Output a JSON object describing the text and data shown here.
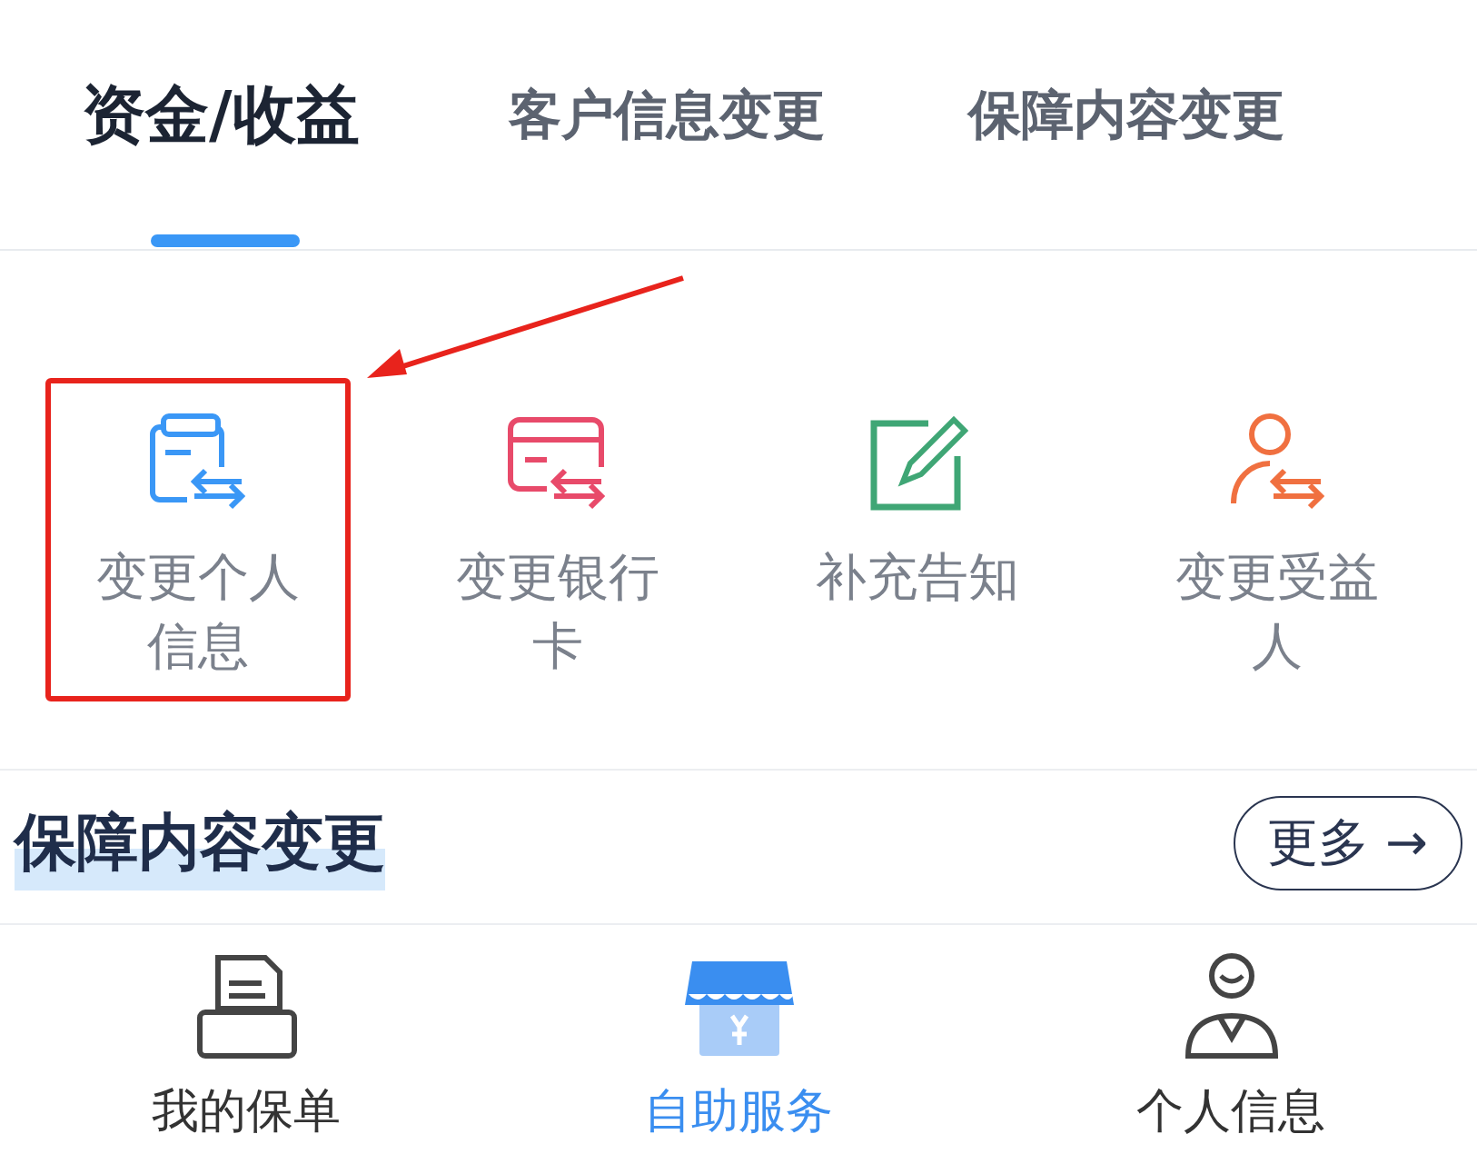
{
  "top_tabs": [
    {
      "label": "资金/收益",
      "selected": true
    },
    {
      "label": "客户信息变更",
      "selected": false
    },
    {
      "label": "保障内容变更",
      "selected": false
    }
  ],
  "sections": [
    {
      "items": [
        {
          "label": "变更个人信息",
          "kind": "doc-swap",
          "color": "#3a97f6",
          "highlighted": true
        },
        {
          "label": "变更银行卡",
          "kind": "card-swap",
          "color": "#e84a6a",
          "highlighted": false
        },
        {
          "label": "补充告知",
          "kind": "edit",
          "color": "#3fa675",
          "highlighted": false
        },
        {
          "label": "变更受益人",
          "kind": "person-swap",
          "color": "#f07040",
          "highlighted": false
        }
      ]
    },
    {
      "title": "保障内容变更",
      "more": "更多 →"
    }
  ],
  "bottom_nav": [
    {
      "label": "我的保单",
      "kind": "printer",
      "selected": false
    },
    {
      "label": "自助服务",
      "kind": "shop",
      "selected": true
    },
    {
      "label": "个人信息",
      "kind": "person",
      "selected": false
    }
  ]
}
